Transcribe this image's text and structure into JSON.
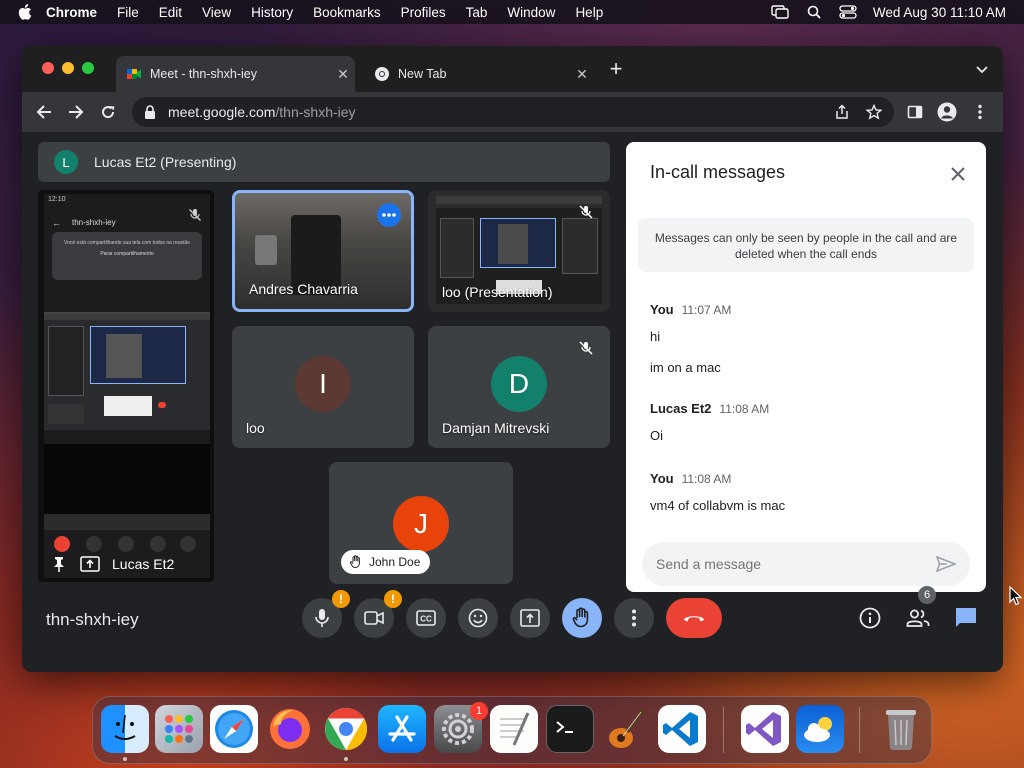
{
  "menubar": {
    "app": "Chrome",
    "items": [
      "File",
      "Edit",
      "View",
      "History",
      "Bookmarks",
      "Profiles",
      "Tab",
      "Window",
      "Help"
    ],
    "clock": "Wed Aug 30  11:10 AM"
  },
  "browser": {
    "tabs": [
      {
        "title": "Meet - thn-shxh-iey",
        "active": true
      },
      {
        "title": "New Tab",
        "active": false
      }
    ],
    "url_host": "meet.google.com",
    "url_path": "/thn-shxh-iey"
  },
  "meet": {
    "presenting": {
      "initial": "L",
      "label": "Lucas Et2 (Presenting)"
    },
    "phone": {
      "time": "12:10",
      "code": "thn-shxh-iey",
      "notice": "Vocé está compartilhando sua tela com todos na reunião",
      "stop_button": "Parar compartilhamento",
      "name": "Lucas Et2"
    },
    "tiles": [
      {
        "name": "Andres Chavarria"
      },
      {
        "name": "loo (Presentation)"
      },
      {
        "name": "loo",
        "initial": "I",
        "color": "#5c3a33"
      },
      {
        "name": "Damjan Mitrevski",
        "initial": "D",
        "color": "#12806b"
      },
      {
        "name": "John Doe",
        "initial": "J",
        "color": "#e8430b"
      }
    ],
    "chat": {
      "title": "In-call messages",
      "info": "Messages can only be seen by people in the call and are deleted when the call ends",
      "messages": [
        {
          "sender": "You",
          "time": "11:07 AM",
          "lines": [
            "hi",
            "im on a mac"
          ]
        },
        {
          "sender": "Lucas Et2",
          "time": "11:08 AM",
          "lines": [
            "Oi"
          ]
        },
        {
          "sender": "You",
          "time": "11:08 AM",
          "lines": [
            "vm4 of collabvm is mac"
          ]
        }
      ],
      "placeholder": "Send a message"
    },
    "meeting_code": "thn-shxh-iey",
    "participant_count": "6"
  },
  "dock": {
    "settings_badge": "1"
  },
  "colors": {
    "leave": "#ea4335",
    "hand_raised": "#8ab4f8",
    "warning": "#f29900",
    "active_speaker_border": "#8ab4f8"
  }
}
